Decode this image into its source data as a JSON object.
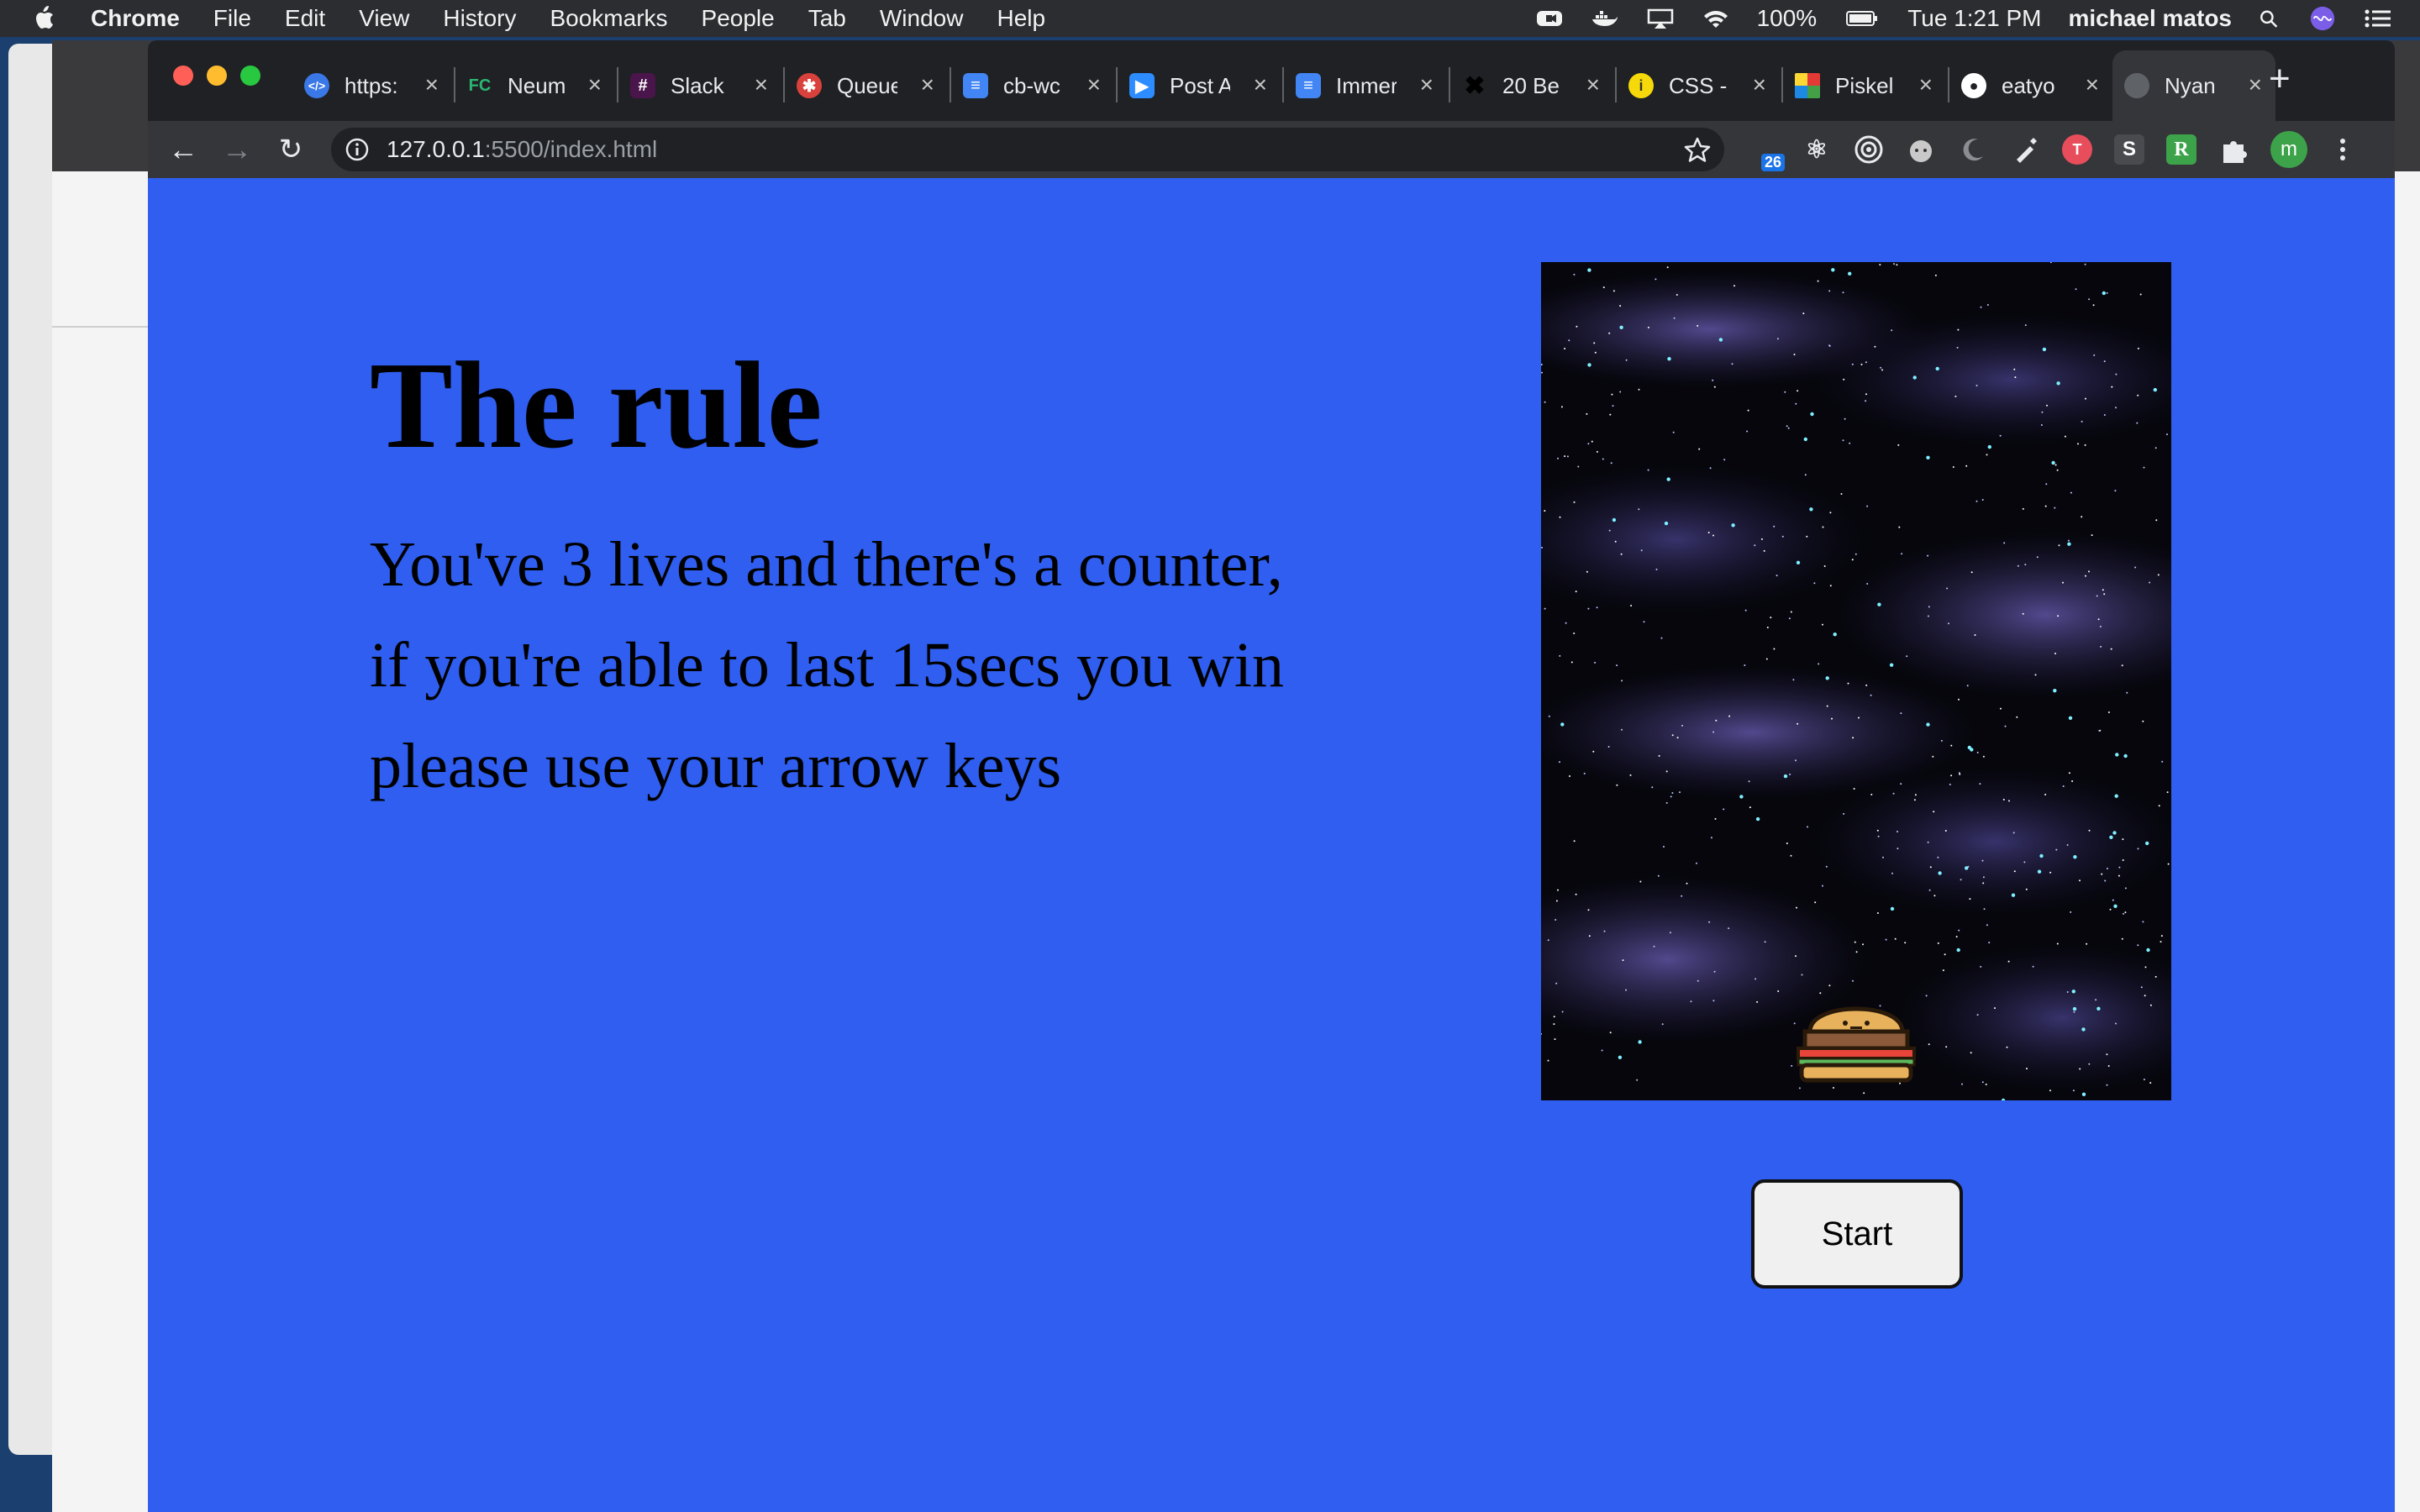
{
  "menubar": {
    "app_name": "Chrome",
    "menus": [
      "File",
      "Edit",
      "View",
      "History",
      "Bookmarks",
      "People",
      "Tab",
      "Window",
      "Help"
    ],
    "battery": "100%",
    "clock": "Tue 1:21 PM",
    "user": "michael matos"
  },
  "tabs": [
    {
      "title": "https:",
      "icon": "code-icon",
      "color": "#3b78e7"
    },
    {
      "title": "Neum",
      "icon": "fc-icon",
      "color": "#2bb673"
    },
    {
      "title": "Slack",
      "icon": "slack-icon",
      "color": "#4a154b"
    },
    {
      "title": "Queue",
      "icon": "queue-icon",
      "color": "#d9423c"
    },
    {
      "title": "cb-wc",
      "icon": "docs-icon",
      "color": "#4285f4"
    },
    {
      "title": "Post A",
      "icon": "zoom-icon",
      "color": "#2d8cff"
    },
    {
      "title": "Immer",
      "icon": "docs-icon",
      "color": "#4285f4"
    },
    {
      "title": "20 Be",
      "icon": "x-icon",
      "color": "#111111"
    },
    {
      "title": "CSS -",
      "icon": "css-icon",
      "color": "#f5d90a"
    },
    {
      "title": "Piskel",
      "icon": "piskel-icon",
      "color": "#3da34a"
    },
    {
      "title": "eatyo",
      "icon": "github-icon",
      "color": "#ffffff"
    },
    {
      "title": "Nyan",
      "icon": "globe-icon",
      "color": "#5f6368"
    }
  ],
  "address_bar": {
    "host": "127.0.0.1",
    "path": ":5500/index.html"
  },
  "extensions": {
    "badge_count": "26",
    "avatar_letter": "m",
    "s_ext": "S",
    "r_ext": "R"
  },
  "page": {
    "title": "The rule",
    "lines": [
      "You've 3 lives and there's a counter,",
      "if you're able to last 15secs you win",
      "please use your arrow keys"
    ],
    "start_label": "Start",
    "background_color": "#2f5ef0"
  }
}
